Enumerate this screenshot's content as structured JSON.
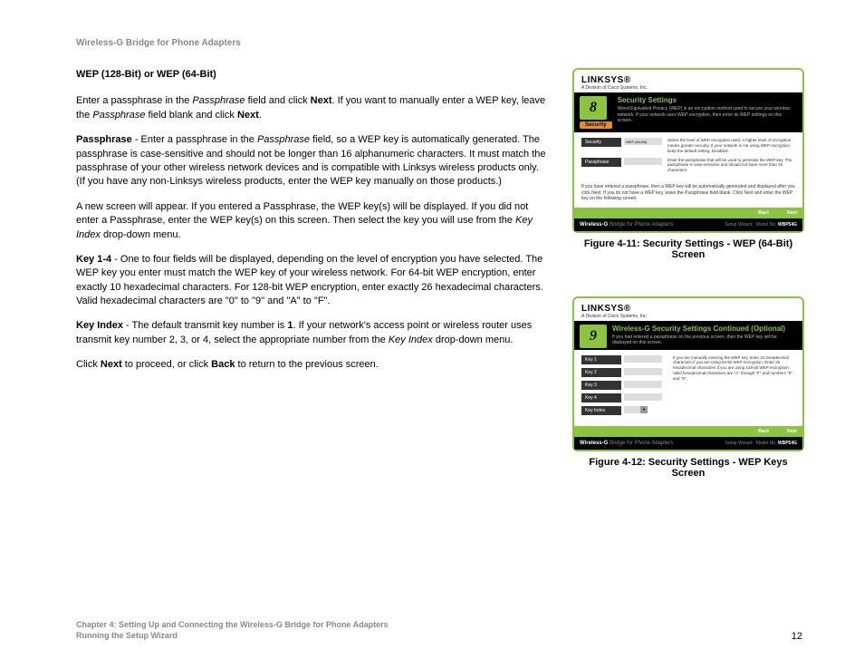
{
  "header": {
    "title": "Wireless-G Bridge for Phone Adapters"
  },
  "main": {
    "heading": "WEP (128-Bit) or WEP (64-Bit)",
    "p1a": "Enter a passphrase in the ",
    "p1b": "Passphrase",
    "p1c": " field and click ",
    "p1d": "Next",
    "p1e": ". If you want to manually enter a WEP key, leave the ",
    "p1f": "Passphrase",
    "p1g": " field blank and click ",
    "p1h": "Next",
    "p1i": ".",
    "p2a": "Passphrase",
    "p2b": " - Enter a passphrase in the ",
    "p2c": "Passphrase",
    "p2d": " field, so a WEP key is automatically generated. The passphrase is case-sensitive and should not be longer than 16 alphanumeric characters. It must match the passphrase of your other wireless network devices and is compatible with Linksys wireless products only. (If you have any non-Linksys wireless products, enter the WEP key manually on those products.)",
    "p3a": "A new screen will appear. If you entered a Passphrase, the WEP key(s) will be displayed. If you did not enter a Passphrase, enter the WEP key(s) on this screen. Then select the key you will use from the ",
    "p3b": "Key Index",
    "p3c": " drop-down menu.",
    "p4a": "Key 1-4",
    "p4b": " - One to four fields will be displayed, depending on the level of encryption you have selected. The WEP key you enter must match the WEP key of your wireless network. For 64-bit WEP encryption, enter exactly 10 hexadecimal characters. For 128-bit WEP encryption, enter exactly 26 hexadecimal characters. Valid hexadecimal characters are \"0\" to \"9\" and \"A\" to \"F\".",
    "p5a": "Key Index",
    "p5b": " - The default transmit key number is ",
    "p5c": "1",
    "p5d": ". If your network's access point or wireless router uses transmit key number 2, 3, or 4, select the appropriate number from the ",
    "p5e": "Key Index",
    "p5f": " drop-down menu.",
    "p6a": "Click ",
    "p6b": "Next",
    "p6c": " to proceed, or click ",
    "p6d": "Back",
    "p6e": " to return to the previous screen."
  },
  "fig1": {
    "logo": "LINKSYS®",
    "logo_sub": "A Division of Cisco Systems, Inc.",
    "step": "8",
    "title": "Security Settings",
    "desc": "Wired Equivalent Privacy (WEP) is an encryption method used to secure your wireless network. If your network uses WEP encryption, then enter its WEP settings on this screen.",
    "security_tab": "Security",
    "row1_label": "Security",
    "row1_val": "WEP (64-Bit)",
    "row1_desc": "Select the level of WEP encryption used. A higher level of encryption means greater security. If your network is not using WEP encryption, keep the default setting, Disabled.",
    "row2_label": "Passphrase",
    "row2_desc": "Enter the passphrase that will be used to generate the WEP key. The passphrase is case-sensitive and should not have more than 16 characters.",
    "note": "If you have entered a passphrase, then a WEP key will be automatically generated and displayed after you click Next. If you do not have a WEP key, leave the Passphrase field blank. Click Next and enter the WEP key on the following screen.",
    "back": "Back",
    "next": "Next",
    "footer_product": "Bridge for Phone Adapters",
    "footer_wizard": "Setup Wizard",
    "footer_model_label": "Model No.",
    "footer_model": "WBP54G",
    "caption": "Figure 4-11: Security Settings - WEP (64-Bit) Screen"
  },
  "fig2": {
    "logo": "LINKSYS®",
    "logo_sub": "A Division of Cisco Systems, Inc.",
    "step": "9",
    "title": "Wireless-G Security Settings Continued (Optional)",
    "desc": "If you had entered a passphrase on the previous screen, then the WEP key will be displayed on this screen.",
    "key1": "Key 1",
    "key2": "Key 2",
    "key3": "Key 3",
    "key4": "Key 4",
    "keyindex": "Key Index",
    "keys_desc": "If you are manually entering the WEP key, enter 10 hexadecimal characters if you are using 64-bit WEP encryption. Enter 26 hexadecimal characters if you are using 128-bit WEP encryption. Valid hexadecimal characters are \"A\" through \"F\" and numbers \"0\" and \"9\".",
    "back": "Back",
    "next": "Next",
    "footer_product": "Bridge for Phone Adapters",
    "footer_wizard": "Setup Wizard",
    "footer_model_label": "Model No.",
    "footer_model": "WBP54G",
    "caption": "Figure 4-12: Security Settings - WEP Keys Screen"
  },
  "footer": {
    "chapter": "Chapter 4: Setting Up and Connecting the Wireless-G Bridge for Phone Adapters",
    "section": "Running the Setup Wizard",
    "page": "12"
  },
  "common": {
    "wireless_g": "Wireless-G"
  }
}
